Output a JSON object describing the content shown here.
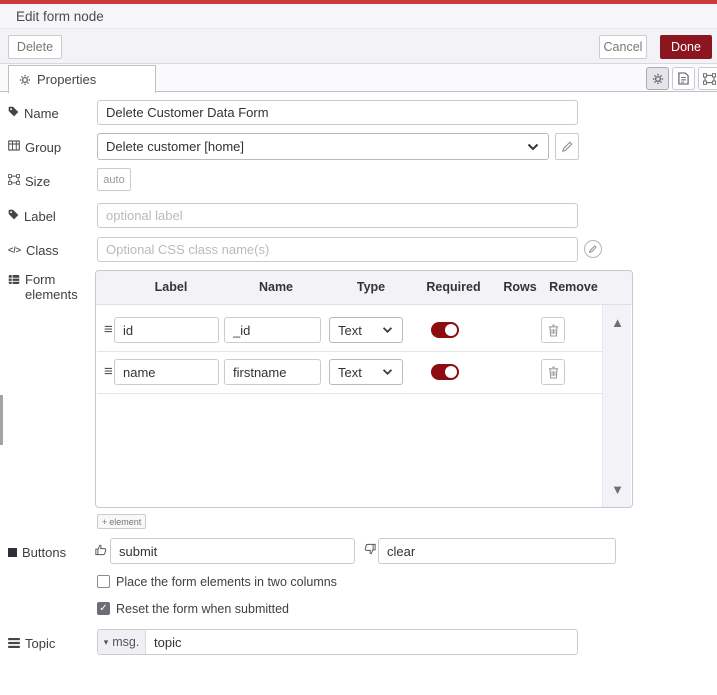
{
  "header": {
    "title": "Edit form node"
  },
  "toolbar": {
    "delete_label": "Delete",
    "cancel_label": "Cancel",
    "done_label": "Done"
  },
  "tabs": {
    "properties_label": "Properties"
  },
  "fields": {
    "name": {
      "label": "Name",
      "value": "Delete Customer Data Form"
    },
    "group": {
      "label": "Group",
      "value": "Delete customer [home]"
    },
    "size": {
      "label": "Size",
      "value": "auto"
    },
    "label": {
      "label": "Label",
      "placeholder": "optional label"
    },
    "css_class": {
      "label": "Class",
      "placeholder": "Optional CSS class name(s)"
    },
    "form_elements": {
      "label": "Form elements"
    },
    "buttons": {
      "label": "Buttons",
      "submit": "submit",
      "clear": "clear"
    },
    "topic": {
      "label": "Topic",
      "prefix": "msg.",
      "value": "topic"
    }
  },
  "elements_table": {
    "headers": [
      "Label",
      "Name",
      "Type",
      "Required",
      "Rows",
      "Remove"
    ],
    "rows": [
      {
        "label": "id",
        "name": "_id",
        "type": "Text",
        "required": true
      },
      {
        "label": "name",
        "name": "firstname",
        "type": "Text",
        "required": true
      }
    ],
    "add_label": "element"
  },
  "options": [
    {
      "label": "Place the form elements in two columns",
      "checked": false
    },
    {
      "label": "Reset the form when submitted",
      "checked": true
    }
  ],
  "icons": {
    "drag_handle": "≡",
    "caret_down": "▾",
    "scroll_up": "▲",
    "scroll_down": "▼",
    "plus": "+",
    "check": "✓",
    "code": "</>"
  },
  "colors": {
    "accent_red": "#c93a3c",
    "done_bg": "#8c161f",
    "toggle_on": "#8e0b10"
  }
}
